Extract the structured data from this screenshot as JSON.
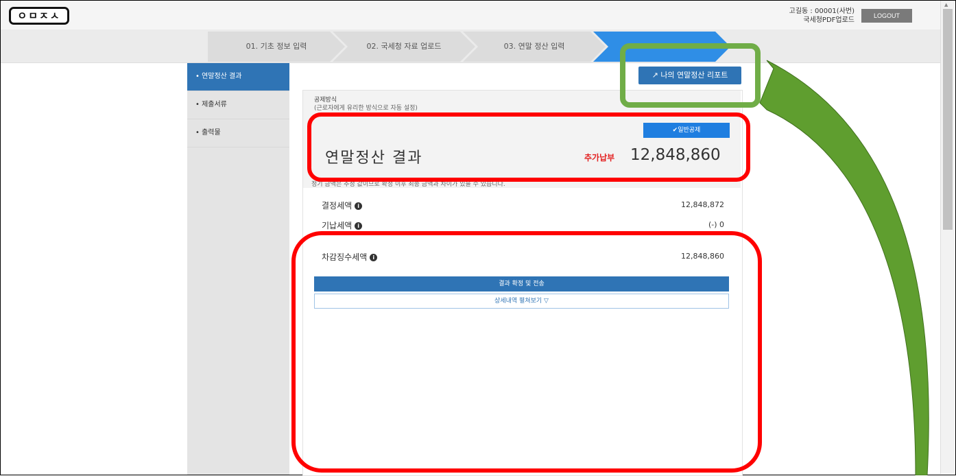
{
  "header": {
    "logo_text": "ㅇㅁㅈㅅ",
    "user_line1": "고길동 : 00001(사번)",
    "user_line2": "국세청PDF업로드",
    "logout_label": "LOGOUT"
  },
  "steps": [
    {
      "label": "01. 기초 정보 입력"
    },
    {
      "label": "02. 국세청 자료 업로드"
    },
    {
      "label": "03. 연말 정산 입력"
    },
    {
      "label": "",
      "active": true
    }
  ],
  "sidebar": {
    "items": [
      {
        "label": "• 연말정산 결과",
        "active": true
      },
      {
        "label": "• 제출서류"
      },
      {
        "label": "• 출력물"
      }
    ]
  },
  "report_button": {
    "label": "나의 연말정산 리포트",
    "icon": "external-link-icon"
  },
  "method": {
    "title": "공제방식",
    "subtitle": "(근로자에게 유리한 방식으로 자동 설정)",
    "selected_label": "✔일반공제"
  },
  "result": {
    "title": "연말정산 결과",
    "status_label": "추가납부",
    "amount": "12,848,860",
    "notice": "정기 금액은 추정 값이므로 확정 이후 최종 금액과 차이가 있을 수 있습니다."
  },
  "rows": [
    {
      "label": "결정세액",
      "value": "12,848,872"
    },
    {
      "label": "기납세액",
      "value": "(-) 0"
    },
    {
      "label": "차감징수세액",
      "value": "12,848,860"
    }
  ],
  "actions": {
    "confirm_label": "결과 확정 및 전송",
    "detail_label": "상세내역 펼쳐보기 ▽"
  },
  "annotations": {
    "red_highlight_color": "#ff0000",
    "green_highlight_color": "#70ad47"
  }
}
